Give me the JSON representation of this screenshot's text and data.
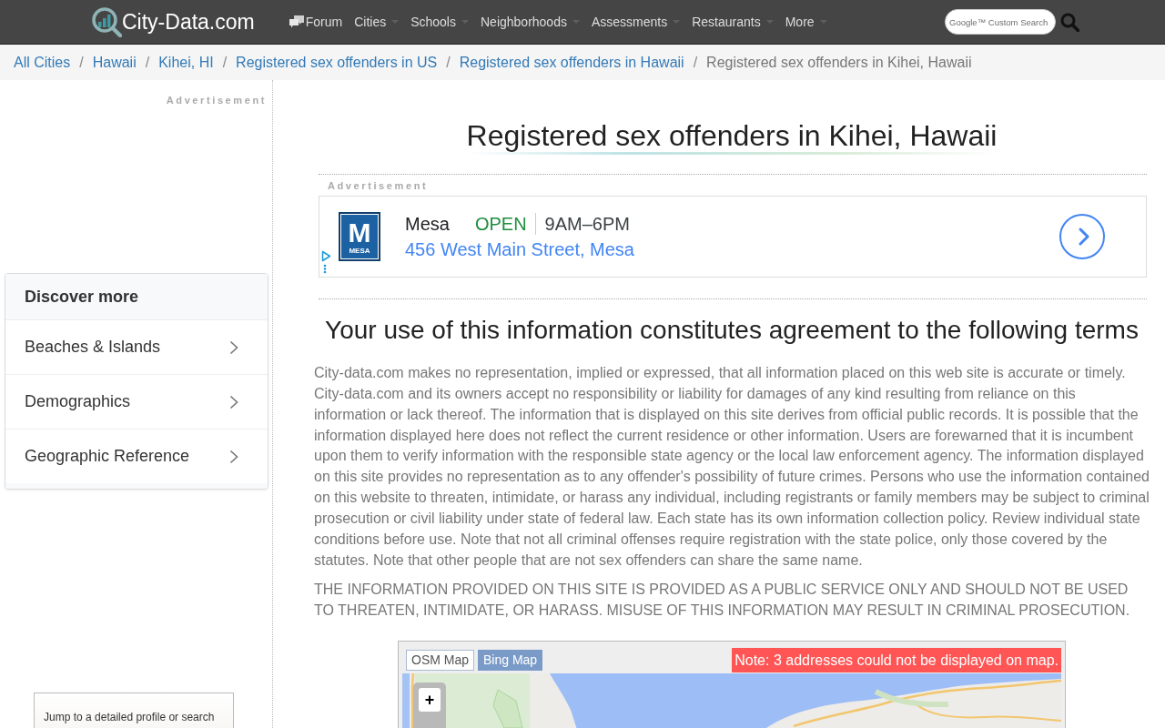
{
  "header": {
    "logo": "City-Data.com",
    "nav": [
      {
        "label": "Forum",
        "kind": "icon"
      },
      {
        "label": "Cities",
        "kind": "dropdown"
      },
      {
        "label": "Schools",
        "kind": "dropdown"
      },
      {
        "label": "Neighborhoods",
        "kind": "dropdown"
      },
      {
        "label": "Assessments",
        "kind": "dropdown"
      },
      {
        "label": "Restaurants",
        "kind": "dropdown"
      },
      {
        "label": "More",
        "kind": "dropdown"
      }
    ],
    "search": {
      "placeholder": "Google™ Custom Search"
    }
  },
  "breadcrumb": {
    "separator": "/",
    "items": [
      {
        "label": "All Cities",
        "kind": "link"
      },
      {
        "label": "Hawaii",
        "kind": "link"
      },
      {
        "label": "Kihei, HI",
        "kind": "link"
      },
      {
        "label": "Registered sex offenders in US",
        "kind": "link"
      },
      {
        "label": "Registered sex offenders in Hawaii",
        "kind": "link"
      },
      {
        "label": "Registered sex offenders in Kihei, Hawaii",
        "kind": "current"
      }
    ]
  },
  "sidebar": {
    "ad_label": "Advertisement",
    "discover": {
      "title": "Discover more",
      "items": [
        "Beaches & Islands",
        "Demographics",
        "Geographic Reference"
      ]
    },
    "jump_box": {
      "text": "Jump to a detailed profile or search"
    }
  },
  "main": {
    "title": "Registered sex offenders in Kihei, Hawaii",
    "ad": {
      "label": "Advertisement",
      "logo_letter": "M",
      "logo_text": "MESA",
      "name": "Mesa",
      "status": "OPEN",
      "hours": "9AM–6PM",
      "address": "456 West Main Street, Mesa"
    },
    "terms": {
      "heading": "Your use of this information constitutes agreement to the following terms",
      "paragraphs": [
        "City-data.com makes no representation, implied or expressed, that all information placed on this web site is accurate or timely. City-data.com and its owners accept no responsibility or liability for damages of any kind resulting from reliance on this information or lack thereof. The information that is displayed on this site derives from official public records. It is possible that the information displayed here does not reflect the current residence or other information. Users are forewarned that it is incumbent upon them to verify information with the responsible state agency or the local law enforcement agency. The information displayed on this site provides no representation as to any offender's possibility of future crimes. Persons who use the information contained on this website to threaten, intimidate, or harass any individual, including registrants or family members may be subject to criminal prosecution or civil liability under state of federal law. Each state has its own information collection policy. Review individual state conditions before use. Note that not all criminal offenses require registration with the state police, only those covered by the statutes. Note that other people that are not sex offenders can share the same name.",
        "THE INFORMATION PROVIDED ON THIS SITE IS PROVIDED AS A PUBLIC SERVICE ONLY AND SHOULD NOT BE USED TO THREATEN, INTIMIDATE, OR HARASS. MISUSE OF THIS INFORMATION MAY RESULT IN CRIMINAL PROSECUTION."
      ]
    },
    "map": {
      "tabs": [
        {
          "label": "OSM Map",
          "selected": true
        },
        {
          "label": "Bing Map",
          "selected": false
        }
      ],
      "note": "Note: 3 addresses could not be displayed on map.",
      "zoom_in": "+"
    }
  }
}
